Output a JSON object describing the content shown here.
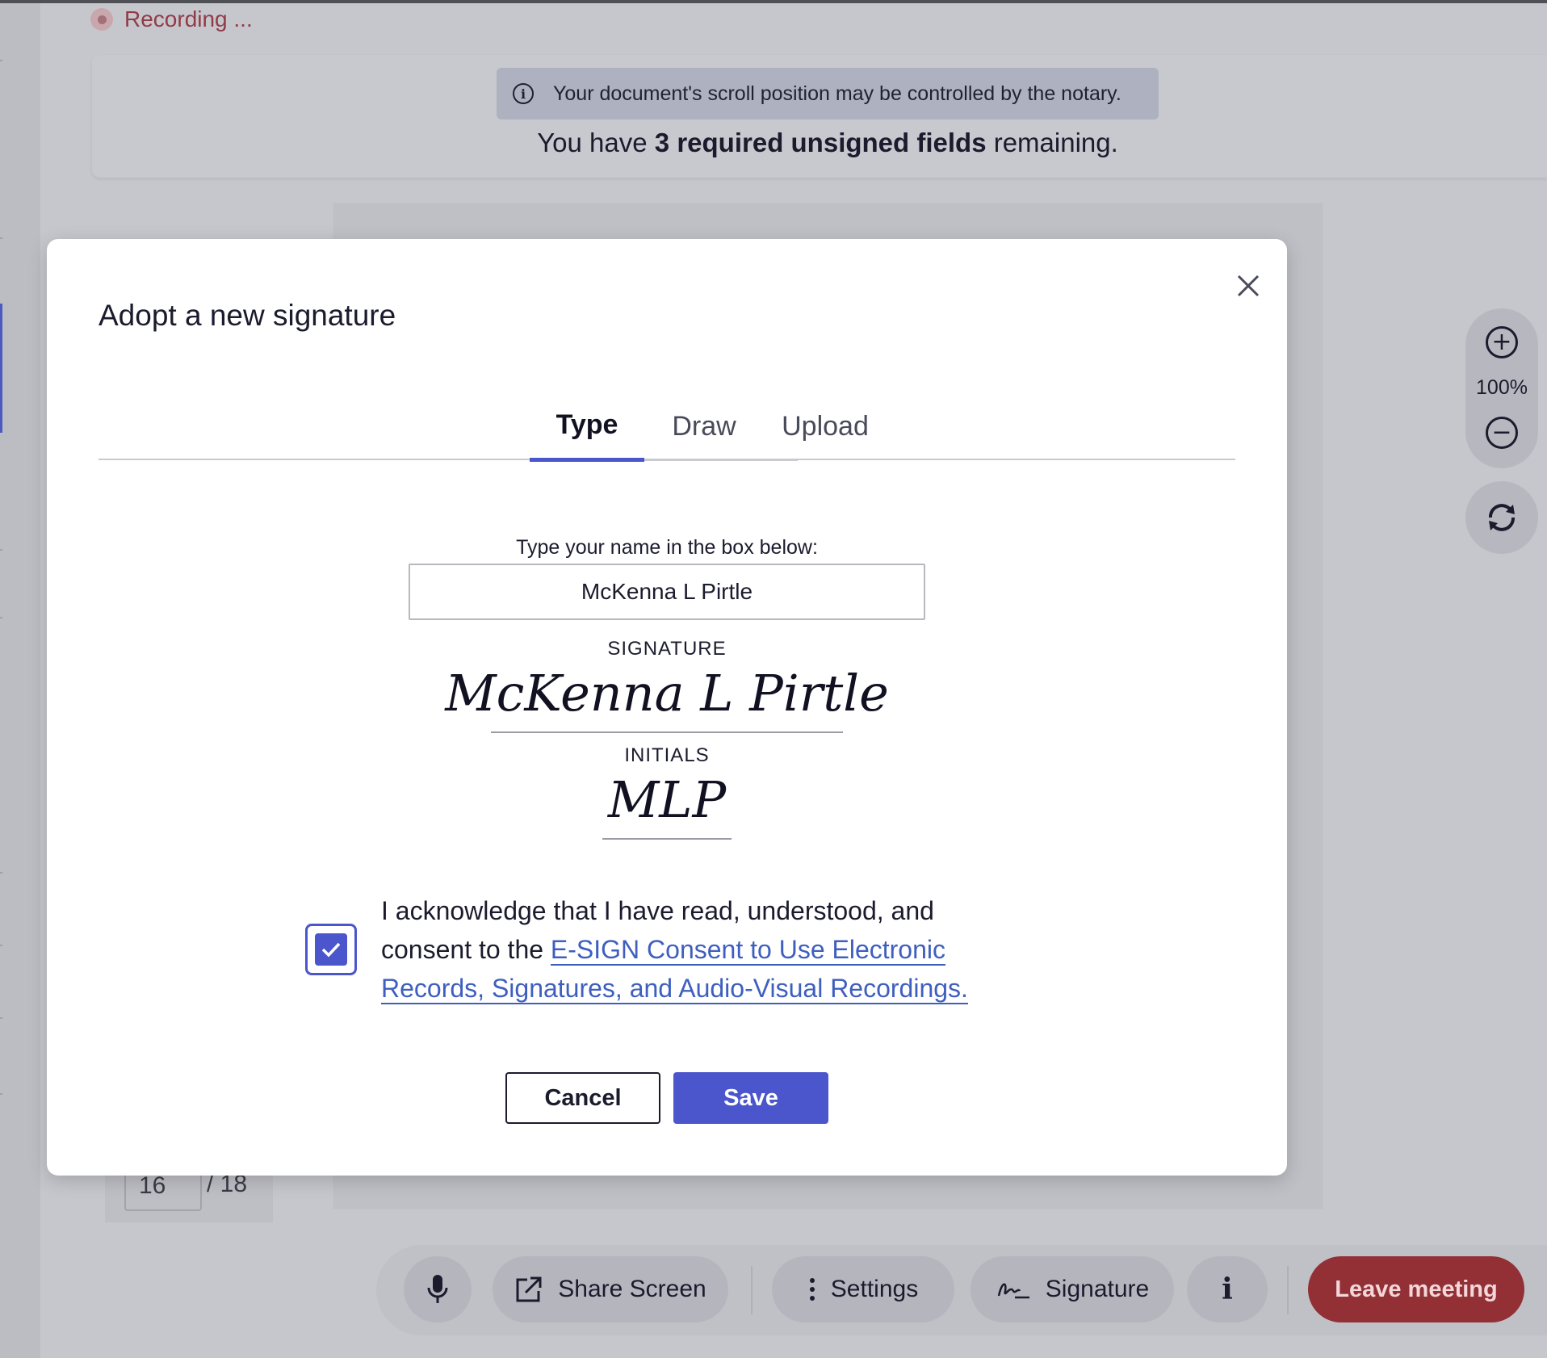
{
  "recording": {
    "label": "Recording ..."
  },
  "notice": {
    "text": "Your document's scroll position may be controlled by the notary."
  },
  "required": {
    "prefix": "You have ",
    "bold": "3 required unsigned fields",
    "suffix": " remaining."
  },
  "page": {
    "current": "16",
    "total": "/ 18"
  },
  "zoom": {
    "level": "100%"
  },
  "toolbar": {
    "share_label": "Share Screen",
    "settings_label": "Settings",
    "signature_label": "Signature",
    "leave_label": "Leave meeting"
  },
  "modal": {
    "title": "Adopt a new signature",
    "tabs": [
      {
        "label": "Type",
        "active": true
      },
      {
        "label": "Draw",
        "active": false
      },
      {
        "label": "Upload",
        "active": false
      }
    ],
    "name_label": "Type your name in the box below:",
    "name_value": "McKenna L Pirtle",
    "signature_heading": "SIGNATURE",
    "signature_preview": "McKenna L Pirtle",
    "initials_heading": "INITIALS",
    "initials_preview": "MLP",
    "ack_text": "I acknowledge that I have read, understood, and consent to the ",
    "ack_link": "E-SIGN Consent to Use Electronic Records, Signatures, and Audio-Visual Recordings.",
    "ack_checked": true,
    "cancel_label": "Cancel",
    "save_label": "Save"
  },
  "colors": {
    "accent": "#4b55cc",
    "leave": "#923036",
    "link": "#3f5fbf",
    "recording": "#923b46"
  }
}
